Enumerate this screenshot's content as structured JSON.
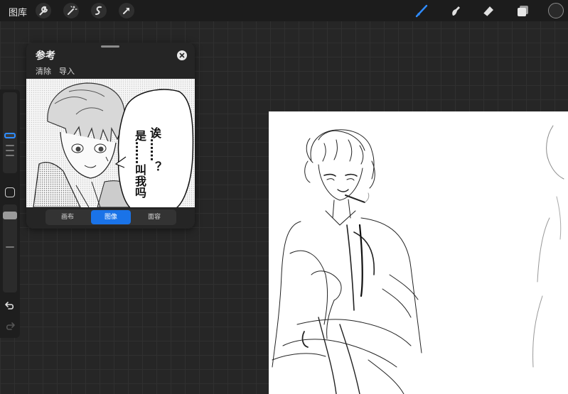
{
  "topbar": {
    "gallery_label": "图库",
    "left_tools": [
      "wrench-icon",
      "magic-wand-icon",
      "selection-icon",
      "transform-arrow-icon"
    ],
    "right_tools": [
      "brush-icon",
      "smudge-icon",
      "eraser-icon",
      "layers-icon"
    ],
    "active_tool": "brush-icon",
    "accent_color": "#2f8cff"
  },
  "sidebar": {
    "controls": [
      "brush-size-slider",
      "modify-button",
      "opacity-slider",
      "undo-icon",
      "redo-icon"
    ]
  },
  "reference": {
    "title": "参考",
    "clear_label": "清除",
    "import_label": "导入",
    "bubble_col1": "诶……？",
    "bubble_col2": "是……叫我吗",
    "tabs": [
      {
        "label": "画布",
        "active": false
      },
      {
        "label": "图像",
        "active": true
      },
      {
        "label": "面容",
        "active": false
      }
    ]
  },
  "colors": {
    "active_tab": "#1a73e8",
    "canvas": "#ffffff",
    "background": "#262626"
  }
}
